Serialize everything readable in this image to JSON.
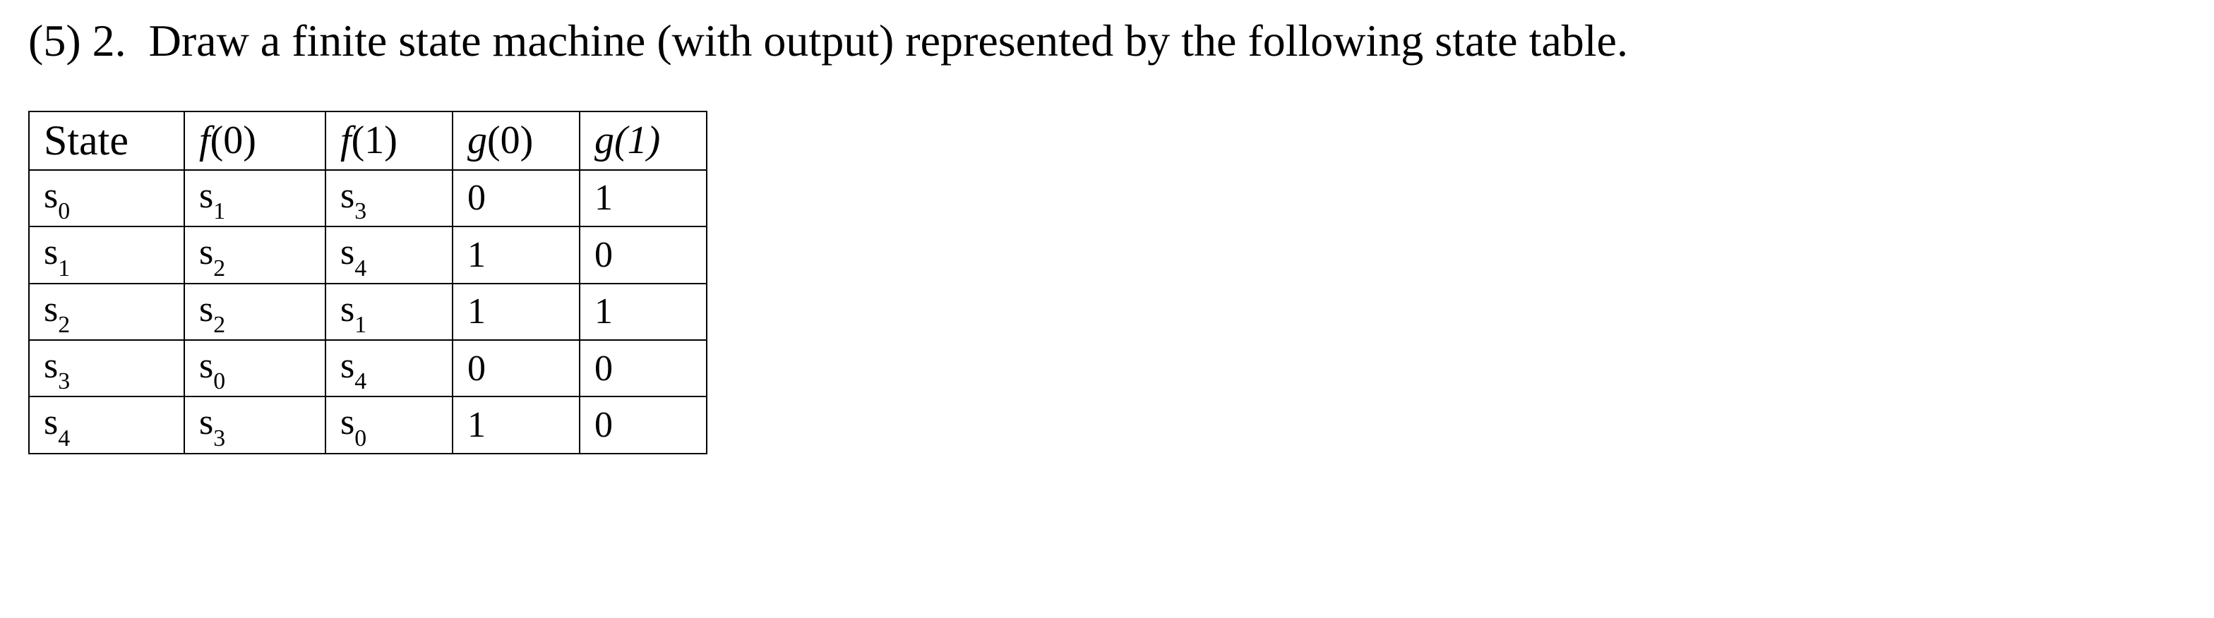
{
  "problem": {
    "points_label": "(5)",
    "number": "2.",
    "text": "Draw a finite state machine (with output) represented by the following state table."
  },
  "table": {
    "headers": {
      "state": "State",
      "f0_func": "f",
      "f0_arg": "(0)",
      "f1_func": "f",
      "f1_arg": "(1)",
      "g0_func": "g",
      "g0_arg": "(0)",
      "g1_func": "g",
      "g1_arg": "(1)"
    },
    "rows": [
      {
        "state_base": "s",
        "state_sub": "0",
        "f0_base": "s",
        "f0_sub": "1",
        "f1_base": "s",
        "f1_sub": "3",
        "g0": "0",
        "g1": "1"
      },
      {
        "state_base": "s",
        "state_sub": "1",
        "f0_base": "s",
        "f0_sub": "2",
        "f1_base": "s",
        "f1_sub": "4",
        "g0": "1",
        "g1": "0"
      },
      {
        "state_base": "s",
        "state_sub": "2",
        "f0_base": "s",
        "f0_sub": "2",
        "f1_base": "s",
        "f1_sub": "1",
        "g0": "1",
        "g1": "1"
      },
      {
        "state_base": "s",
        "state_sub": "3",
        "f0_base": "s",
        "f0_sub": "0",
        "f1_base": "s",
        "f1_sub": "4",
        "g0": "0",
        "g1": "0"
      },
      {
        "state_base": "s",
        "state_sub": "4",
        "f0_base": "s",
        "f0_sub": "3",
        "f1_base": "s",
        "f1_sub": "0",
        "g0": "1",
        "g1": "0"
      }
    ]
  }
}
